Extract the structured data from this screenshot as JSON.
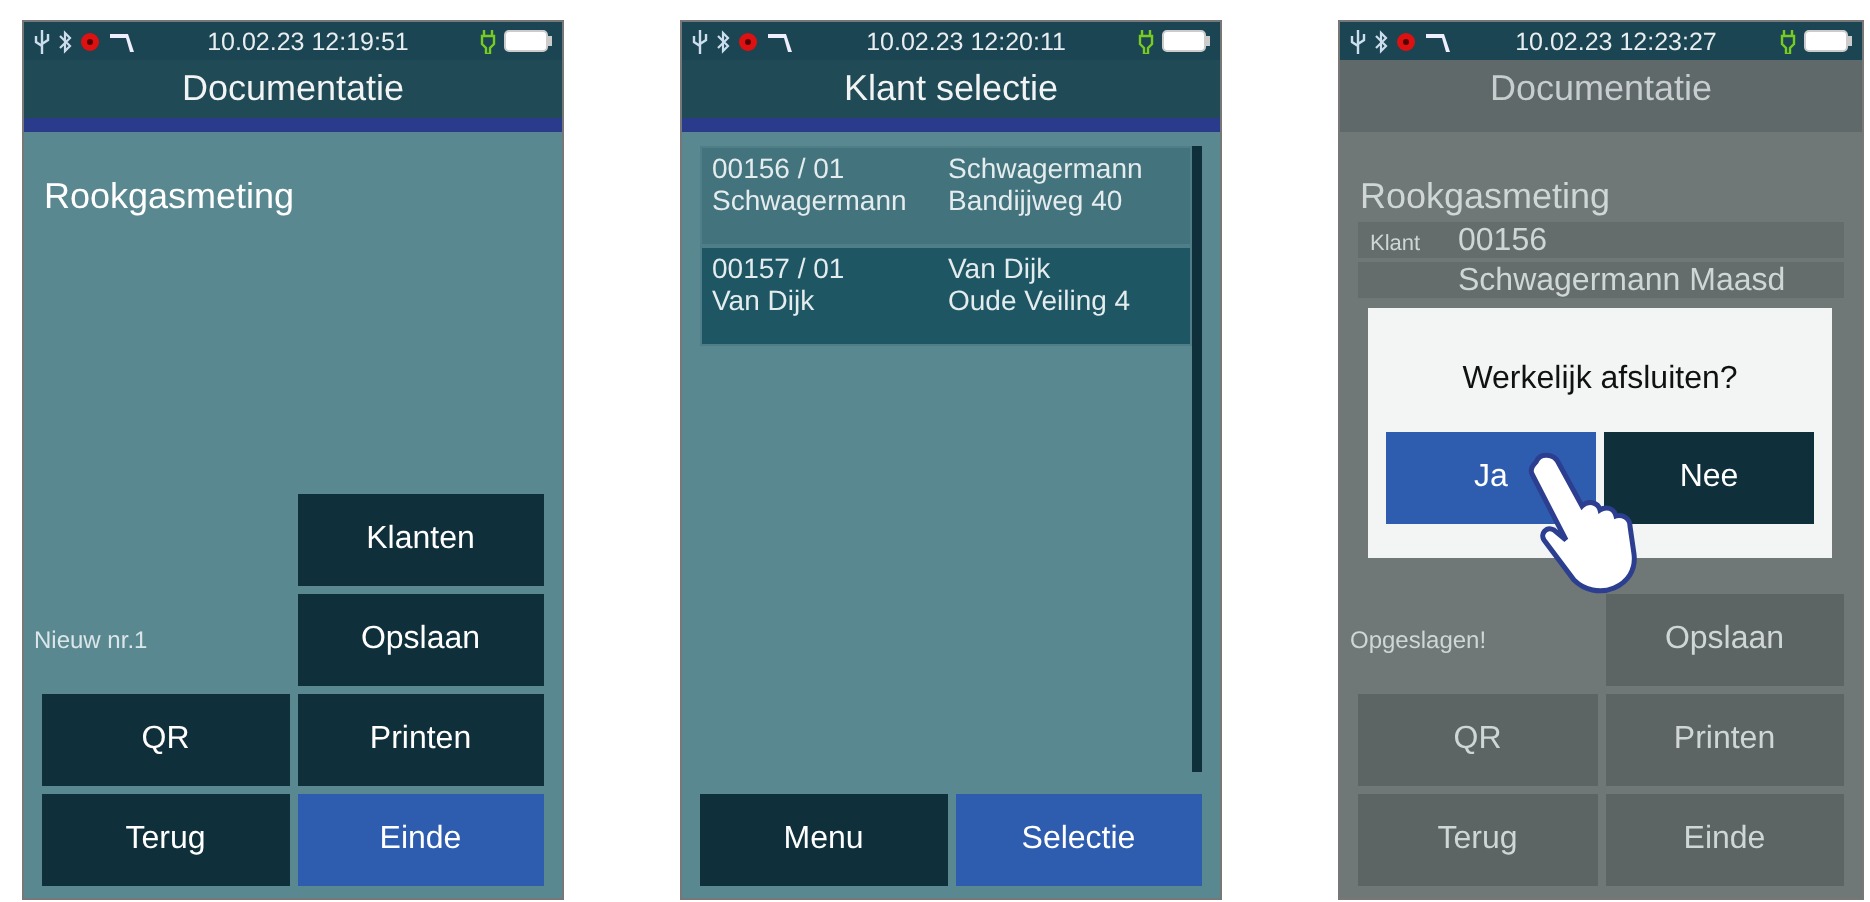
{
  "screens": [
    {
      "kind": "menu",
      "dimmed": false,
      "time": "10.02.23 12:19:51",
      "title": "Documentatie",
      "heading": "Rookgasmeting",
      "note": "Nieuw nr.1",
      "right_buttons": [
        {
          "label": "Klanten",
          "highlighted": false
        },
        {
          "label": "Opslaan",
          "highlighted": false
        },
        {
          "label": "Printen",
          "highlighted": false
        },
        {
          "label": "Einde",
          "highlighted": true
        }
      ],
      "left_buttons": [
        {
          "label": "QR",
          "highlighted": false
        },
        {
          "label": "Terug",
          "highlighted": false
        }
      ]
    },
    {
      "kind": "list",
      "dimmed": false,
      "time": "10.02.23 12:20:11",
      "title": "Klant selectie",
      "items": [
        {
          "number": "00156 / 01",
          "name": "Schwagermann",
          "contact": "Schwagermann",
          "address": "Bandijjweg 40",
          "selected": false
        },
        {
          "number": "00157 / 01",
          "name": "Van Dijk",
          "contact": "Van Dijk",
          "address": "Oude Veiling 4",
          "selected": true
        }
      ],
      "buttons": [
        {
          "label": "Menu",
          "highlighted": false
        },
        {
          "label": "Selectie",
          "highlighted": true
        }
      ]
    },
    {
      "kind": "menu",
      "dimmed": true,
      "time": "10.02.23 12:23:27",
      "title": "Documentatie",
      "heading": "Rookgasmeting",
      "fields": [
        {
          "label": "Klant",
          "value": "00156"
        },
        {
          "value": "Schwagermann Maasd"
        }
      ],
      "note": "Opgeslagen!",
      "right_buttons": [
        {
          "label": "Opslaan",
          "highlighted": false
        },
        {
          "label": "Printen",
          "highlighted": false
        },
        {
          "label": "Einde",
          "highlighted": false
        }
      ],
      "left_buttons": [
        {
          "label": "QR",
          "highlighted": false
        },
        {
          "label": "Terug",
          "highlighted": false
        }
      ],
      "dialog": {
        "question": "Werkelijk afsluiten?",
        "buttons": [
          {
            "label": "Ja",
            "highlighted": true
          },
          {
            "label": "Nee",
            "highlighted": false
          }
        ]
      }
    }
  ]
}
